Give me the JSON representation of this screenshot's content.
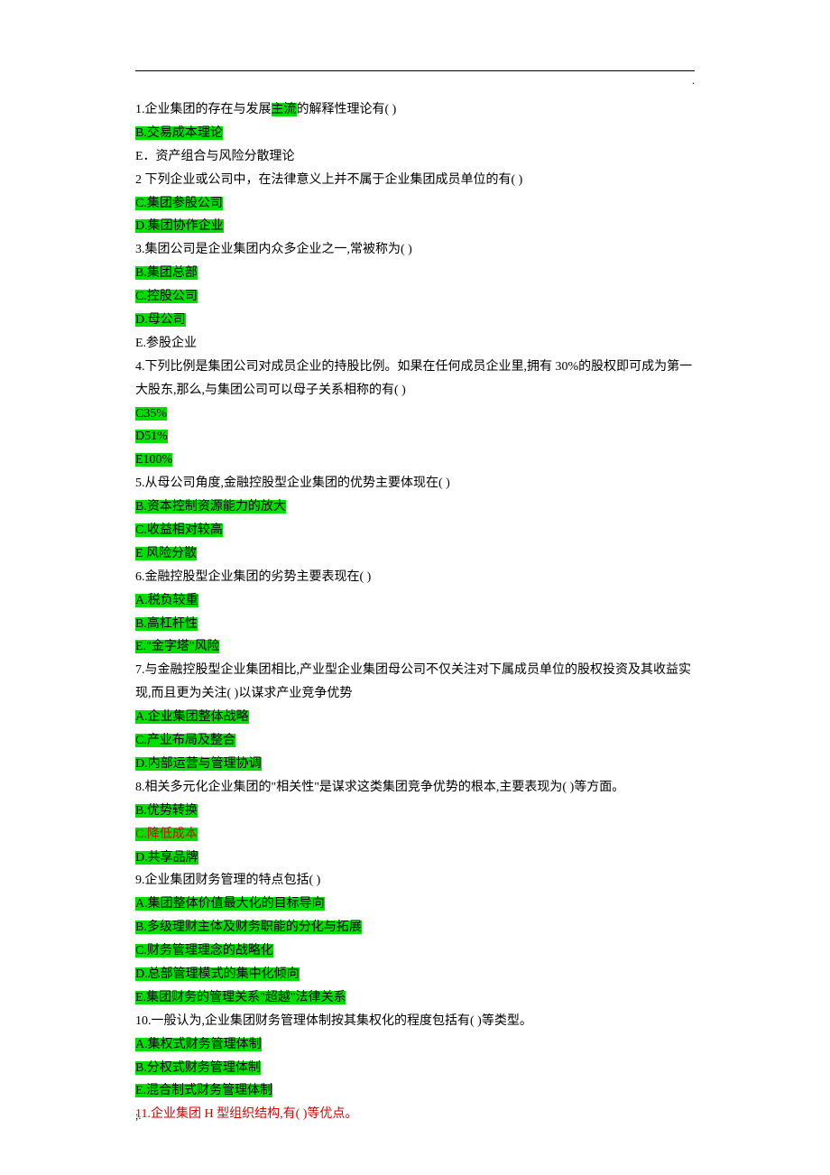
{
  "topDot": ".",
  "footer": ";.",
  "lines": [
    {
      "kind": "mixed",
      "parts": [
        {
          "t": "1.企业集团的存在与发展"
        },
        {
          "t": "主流",
          "hl": true
        },
        {
          "t": "的解释性理论有( )"
        }
      ]
    },
    {
      "kind": "hl",
      "text": "B.交易成本理论"
    },
    {
      "kind": "plain",
      "text": "E．资产组合与风险分散理论"
    },
    {
      "kind": "plain",
      "text": "2 下列企业或公司中，在法律意义上并不属于企业集团成员单位的有( )"
    },
    {
      "kind": "hl",
      "text": "C.集团参股公司"
    },
    {
      "kind": "hl",
      "text": "D.集团协作企业"
    },
    {
      "kind": "plain",
      "text": "3.集团公司是企业集团内众多企业之一,常被称为( )"
    },
    {
      "kind": "hl",
      "text": "B.集团总部"
    },
    {
      "kind": "hl",
      "text": "C.控股公司"
    },
    {
      "kind": "hl",
      "text": "D.母公司"
    },
    {
      "kind": "plain",
      "text": "E.参股企业"
    },
    {
      "kind": "plain",
      "text": "4.下列比例是集团公司对成员企业的持股比例。如果在任何成员企业里,拥有 30%的股权即可成为第一大股东,那么,与集团公司可以母子关系相称的有( )"
    },
    {
      "kind": "hl",
      "text": "C35%"
    },
    {
      "kind": "hl",
      "text": "D51%"
    },
    {
      "kind": "hl",
      "text": "E100%"
    },
    {
      "kind": "plain",
      "text": "5.从母公司角度,金融控股型企业集团的优势主要体现在( )"
    },
    {
      "kind": "hl",
      "text": "B.资本控制资源能力的放大"
    },
    {
      "kind": "hl",
      "text": "C.收益相对较高"
    },
    {
      "kind": "hl",
      "text": "E 风险分散"
    },
    {
      "kind": "plain",
      "text": "6.金融控股型企业集团的劣势主要表现在( )"
    },
    {
      "kind": "hl",
      "text": "A.税负较重"
    },
    {
      "kind": "hl",
      "text": "B.高杠杆性"
    },
    {
      "kind": "hl",
      "text": "E.\"金字塔\"风险"
    },
    {
      "kind": "plain",
      "text": "7.与金融控股型企业集团相比,产业型企业集团母公司不仅关注对下属成员单位的股权投资及其收益实现,而且更为关注( )以谋求产业竞争优势"
    },
    {
      "kind": "hl",
      "text": "A.企业集团整体战略"
    },
    {
      "kind": "hl",
      "text": "C.产业布局及整合"
    },
    {
      "kind": "hl",
      "text": "D.内部运营与管理协调"
    },
    {
      "kind": "plain",
      "text": "8.相关多元化企业集团的\"相关性\"是谋求这类集团竞争优势的根本,主要表现为( )等方面。"
    },
    {
      "kind": "hl",
      "text": "B.优势转换"
    },
    {
      "kind": "hl-red",
      "text": "C.降低成本"
    },
    {
      "kind": "hl",
      "text": "D.共享品牌"
    },
    {
      "kind": "plain",
      "text": "9.企业集团财务管理的特点包括( )"
    },
    {
      "kind": "hl",
      "text": "A.集团整体价值最大化的目标导向"
    },
    {
      "kind": "hl",
      "text": "B.多级理财主体及财务职能的分化与拓展"
    },
    {
      "kind": "hl",
      "text": "C.财务管理理念的战略化"
    },
    {
      "kind": "hl",
      "text": "D.总部管理模式的集中化倾向"
    },
    {
      "kind": "hl",
      "text": "E.集团财务的管理关系\"超越\"法律关系"
    },
    {
      "kind": "plain",
      "text": "10.一般认为,企业集团财务管理体制按其集权化的程度包括有( )等类型。"
    },
    {
      "kind": "hl",
      "text": "A.集权式财务管理体制"
    },
    {
      "kind": "hl",
      "text": "B.分权式财务管理体制"
    },
    {
      "kind": "hl",
      "text": "E.混合制式财务管理体制"
    },
    {
      "kind": "red",
      "text": "11.企业集团 H 型组织结构,有( )等优点。"
    }
  ]
}
